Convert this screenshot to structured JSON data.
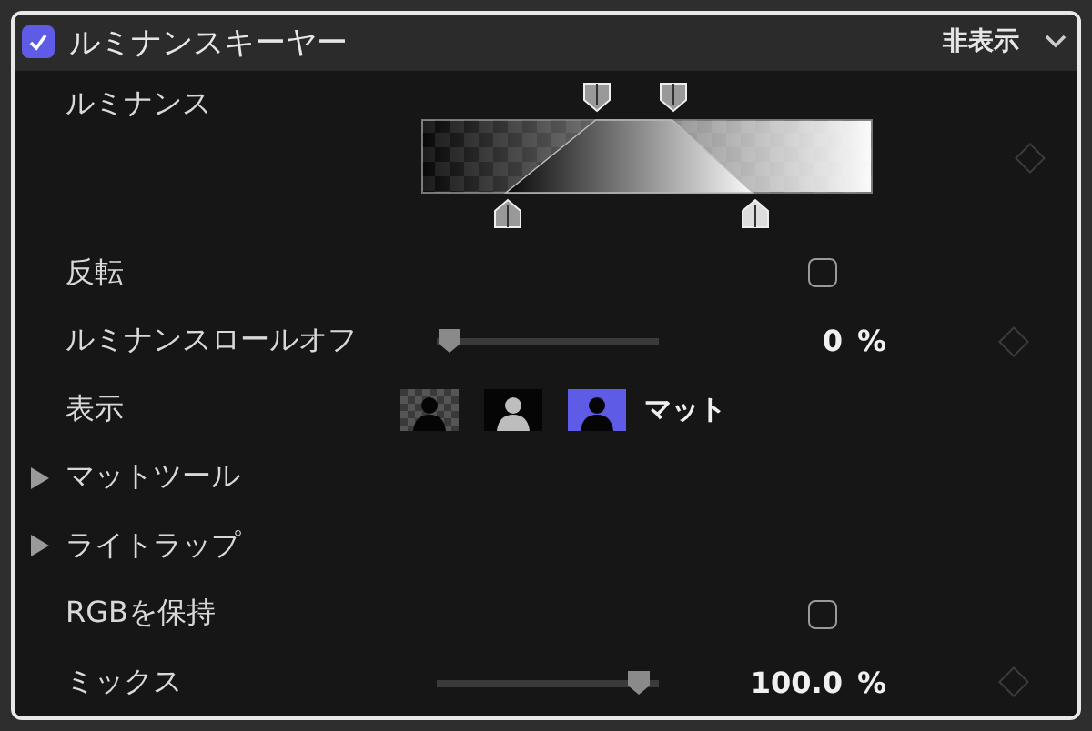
{
  "effect": {
    "enabled": true,
    "title": "ルミナンスキーヤー",
    "visibility": "非表示"
  },
  "rows": [
    {
      "kind": "luminance",
      "label": "ルミナンス"
    },
    {
      "kind": "checkbox",
      "label": "反転",
      "checked": false
    },
    {
      "kind": "slider",
      "label": "ルミナンスロールオフ",
      "level": 0,
      "value": "0",
      "unit": "%"
    },
    {
      "kind": "view",
      "label": "表示",
      "options": [
        {
          "kind": "checker",
          "selected": false
        },
        {
          "kind": "inverse",
          "selected": false
        },
        {
          "kind": "solid",
          "selected": true
        }
      ],
      "caption": "マット"
    },
    {
      "kind": "group",
      "label": "マットツール",
      "expanded": false
    },
    {
      "kind": "group",
      "label": "ライトラップ",
      "expanded": false
    },
    {
      "kind": "checkbox",
      "label": "RGBを保持",
      "checked": false
    },
    {
      "kind": "slider",
      "label": "ミックス",
      "level": 0.96,
      "value": "100.0",
      "unit": "%"
    }
  ]
}
